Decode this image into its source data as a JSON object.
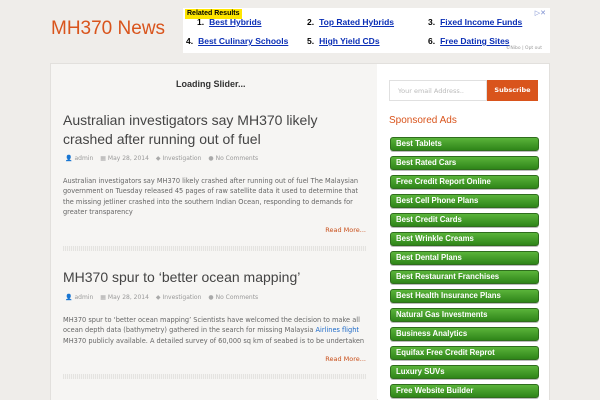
{
  "site": {
    "title": "MH370 News"
  },
  "top_ad": {
    "badge": "Related Results",
    "close": "▷✕",
    "optout": "©Nibo | Opt out",
    "links": [
      {
        "num": "1.",
        "label": "Best Hybrids"
      },
      {
        "num": "2.",
        "label": "Top Rated Hybrids"
      },
      {
        "num": "3.",
        "label": "Fixed Income Funds"
      },
      {
        "num": "4.",
        "label": "Best Culinary Schools"
      },
      {
        "num": "5.",
        "label": "High Yield CDs"
      },
      {
        "num": "6.",
        "label": "Free Dating Sites"
      }
    ]
  },
  "slider": {
    "loading": "Loading Slider..."
  },
  "posts": [
    {
      "title": "Australian investigators say MH370 likely crashed after running out of fuel",
      "author": "admin",
      "date": "May 28, 2014",
      "category": "Investigation",
      "comments": "No Comments",
      "excerpt": "Australian investigators say MH370 likely crashed after running out of fuel   The Malaysian government on Tuesday released 45 pages of raw satellite data it used to determine that the missing jetliner crashed into the southern Indian Ocean, responding to demands for greater transparency",
      "read_more": "Read More..."
    },
    {
      "title": "MH370 spur to ‘better ocean mapping’",
      "author": "admin",
      "date": "May 28, 2014",
      "category": "Investigation",
      "comments": "No Comments",
      "excerpt_pre": "MH370 spur to ‘better ocean mapping’   Scientists have welcomed the decision to make all ocean depth data (bathymetry) gathered in the search for missing Malaysia ",
      "excerpt_link": "Airlines flight",
      "excerpt_post": " MH370 publicly available. A detailed survey of 60,000 sq km of seabed is to be undertaken",
      "read_more": "Read More..."
    }
  ],
  "subscribe": {
    "placeholder": "Your email Address..",
    "button": "Subscribe"
  },
  "sidebar": {
    "heading": "Sponsored Ads",
    "ads": [
      "Best Tablets",
      "Best Rated Cars",
      "Free Credit Report Online",
      "Best Cell Phone Plans",
      "Best Credit Cards",
      "Best Wrinkle Creams",
      "Best Dental Plans",
      "Best Restaurant Franchises",
      "Best Health Insurance Plans",
      "Natural Gas Investments",
      "Business Analytics",
      "Equifax Free Credit Reprot",
      "Luxury SUVs",
      "Free Website Builder"
    ]
  },
  "colors": {
    "accent": "#d9541c",
    "ad_green": "#3f9a25",
    "link_blue": "#0a2eb5"
  }
}
